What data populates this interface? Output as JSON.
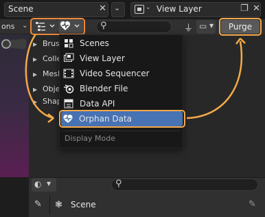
{
  "topbar": {
    "scene_label": "Scene",
    "view_layer_label": "View Layer"
  },
  "viewport": {
    "mode_label": "ons"
  },
  "outliner": {
    "purge_label": "Purge",
    "rows": [
      "Brus",
      "Colle",
      "Mesh",
      "Obje",
      "Shap"
    ]
  },
  "display_mode_menu": {
    "items": [
      {
        "label": "Scenes",
        "icon": "scenes-icon"
      },
      {
        "label": "View Layer",
        "icon": "view-layer-icon"
      },
      {
        "label": "Video Sequencer",
        "icon": "video-sequencer-icon"
      },
      {
        "label": "Blender File",
        "icon": "blender-file-icon"
      },
      {
        "label": "Data API",
        "icon": "data-api-icon"
      },
      {
        "label": "Orphan Data",
        "icon": "orphan-data-icon",
        "selected": true
      }
    ],
    "footer_label": "Display Mode"
  },
  "properties": {
    "scene_label": "Scene"
  },
  "colors": {
    "highlight_orange": "#f08a3c",
    "annotation_orange": "#f5a94a",
    "selection_blue": "#4772b3"
  }
}
